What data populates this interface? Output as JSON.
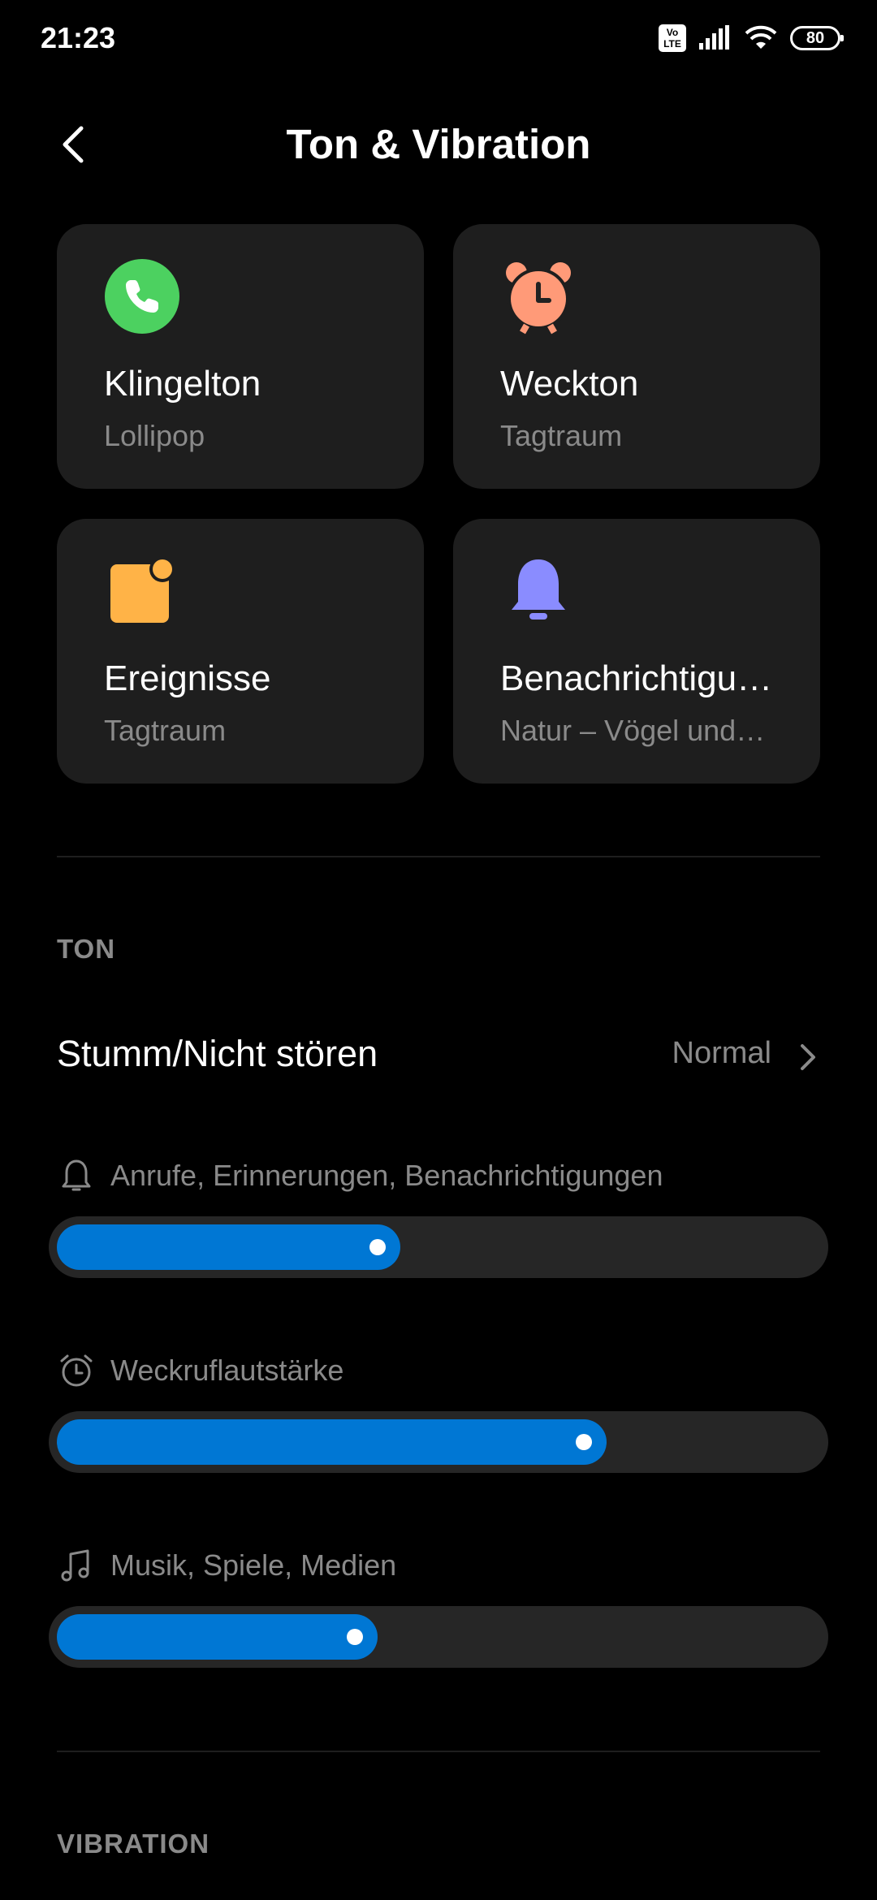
{
  "status_bar": {
    "time": "21:23",
    "volte": "Vo\nLTE",
    "battery": "80"
  },
  "header": {
    "title": "Ton & Vibration"
  },
  "cards": [
    {
      "title": "Klingelton",
      "subtitle": "Lollipop",
      "icon": "phone-icon",
      "color": "#4cd160"
    },
    {
      "title": "Weckton",
      "subtitle": "Tagtraum",
      "icon": "alarm-clock-icon",
      "color": "#ff9a78"
    },
    {
      "title": "Ereignisse",
      "subtitle": "Tagtraum",
      "icon": "calendar-note-icon",
      "color": "#ffb347"
    },
    {
      "title": "Benachrichtigu…",
      "subtitle": "Natur – Vögel und…",
      "icon": "bell-icon",
      "color": "#8a8cff"
    }
  ],
  "sections": {
    "ton": "TON",
    "vibration": "VIBRATION"
  },
  "mode_row": {
    "label": "Stumm/Nicht stören",
    "value": "Normal"
  },
  "volumes": [
    {
      "label": "Anrufe, Erinnerungen, Benachrichtigungen",
      "icon": "bell-outline-icon",
      "level_percent": 45
    },
    {
      "label": "Weckruflautstärke",
      "icon": "alarm-outline-icon",
      "level_percent": 72
    },
    {
      "label": "Musik, Spiele, Medien",
      "icon": "music-note-icon",
      "level_percent": 42
    }
  ],
  "colors": {
    "accent": "#0077d4",
    "card_bg": "#1e1e1e",
    "secondary_text": "#8a8a8a"
  }
}
